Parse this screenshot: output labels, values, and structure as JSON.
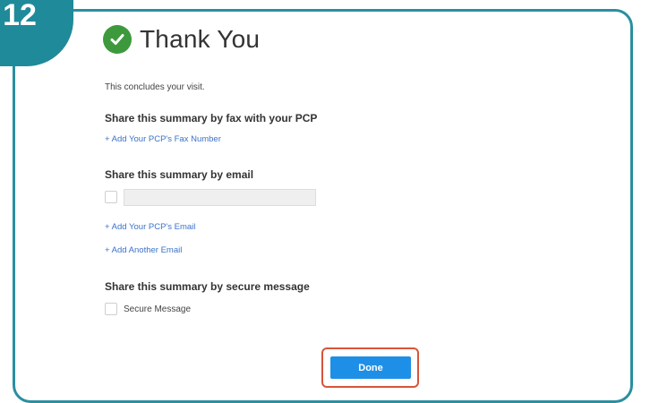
{
  "step_badge": "12",
  "title": "Thank You",
  "intro": "This concludes your visit.",
  "fax_section": {
    "heading": "Share this summary by fax with your PCP",
    "add_link": "+ Add Your PCP's Fax Number"
  },
  "email_section": {
    "heading": "Share this summary by email",
    "email_value": "",
    "add_pcp_email_link": "+ Add Your PCP's Email",
    "add_another_email_link": "+ Add Another Email"
  },
  "secure_section": {
    "heading": "Share this summary by secure message",
    "checkbox_label": "Secure Message"
  },
  "done_button": "Done",
  "colors": {
    "teal": "#2a8fa0",
    "check_green": "#3c9a3c",
    "link_blue": "#3b73c8",
    "button_blue": "#1e8fe6",
    "highlight_red": "#d9543a"
  },
  "icons": {
    "success": "check-circle-icon"
  }
}
